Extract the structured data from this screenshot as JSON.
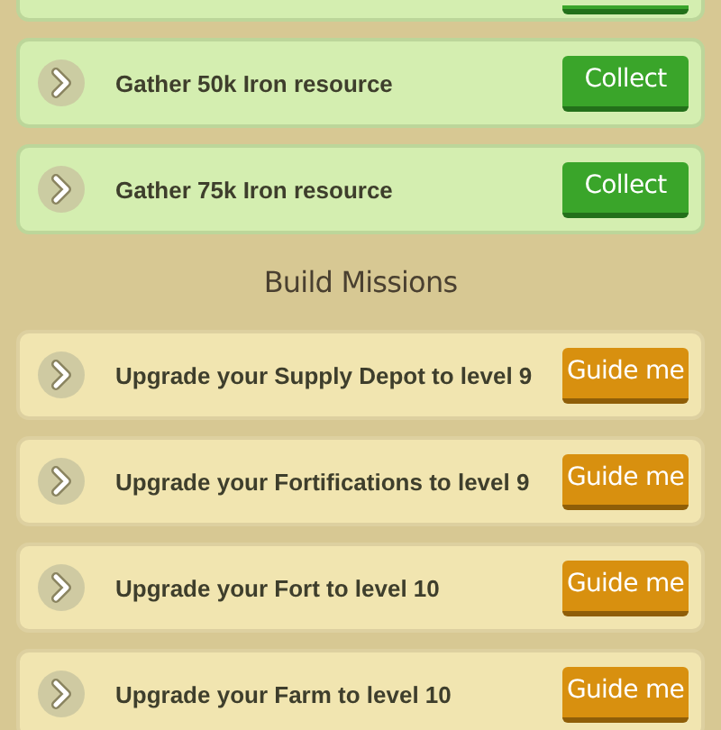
{
  "resource_missions": [
    {
      "label": "Gather 50k Iron resource",
      "button": "Collect",
      "kind": "collect"
    },
    {
      "label": "Gather 75k Iron resource",
      "button": "Collect",
      "kind": "collect"
    }
  ],
  "build_heading": "Build Missions",
  "build_missions": [
    {
      "label": "Upgrade your Supply Depot to level 9",
      "button": "Guide me",
      "kind": "guide"
    },
    {
      "label": "Upgrade your Fortifications to level 9",
      "button": "Guide me",
      "kind": "guide"
    },
    {
      "label": "Upgrade your Fort to level 10",
      "button": "Guide me",
      "kind": "guide"
    },
    {
      "label": "Upgrade your Farm to level 10",
      "button": "Guide me",
      "kind": "guide"
    }
  ]
}
